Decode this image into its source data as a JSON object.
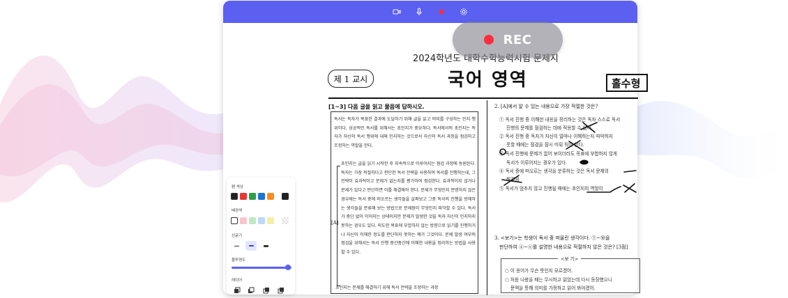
{
  "titlebar": {
    "icons": [
      "video-icon",
      "microphone-icon",
      "record-icon",
      "settings-icon"
    ],
    "accent": "#5b60f0"
  },
  "recording": {
    "label": "REC",
    "dot_color": "#ff2d3d"
  },
  "document": {
    "header_line": "2024학년도 대학수학능력시험 문제지",
    "session": "제 1 교시",
    "subject": "국어 영역",
    "required": "홀수형",
    "left": {
      "question_range": "[1~3] 다음 글을 읽고 물음에 답하시오.",
      "para1": "독서는 독자가 목표한 결과에 도달하기 위해 글을 읽고 의미를 구성하는 인지 행위이다. 성공적인 독서를 위해서는 초인지가 중요하다. 독서에서의 초인지는 독자가 자신의 독서 행위에 대해 인지하는 것으로서 자신의 독서 과정을 점검하고 조정하는 역할을 한다.",
      "para2": "초인지는 글을 읽기 시작한 후 지속적으로 이루어지는 점검 과정에 동원된다. 독자는 가장 적절하다고 판단한 독서 전략을 사용하여 독서를 진행하는데, 그 전략이 효과적이고 문제가 없는지를 평가하여 점검한다. 효과적이지 않거나 문제가 있다고 판단하면 이를 해결해야 한다. 문제가 무엇인지 분명하지 않은 경우에는 독서 중에 떠오르는 생각들을 살펴보고 그중 독서의 진행을 방해하는 생각들을 분류해 보는 방법으로 문제점이 무엇인지 파악할 수 있다. 독서가 중단 없이 이어지는 상태이지만 문제가 발생한 것을 독자 자신이 인지하지 못하는 경우도 있다. 의도한 목표에 부합하지 않는 방향으로 읽기를 진행하거나 자신이 이해한 정도를 판단하지 못하는 예가 그것이다. 문제 발생 여부의 점검을 위해서는 독서 진행 중간중간에 이해한 내용을 정리하는 방법을 사용할 수 있다.",
      "bracket": "[A]",
      "para3_start": "초인지는 문제를 해결하기 위해 독서 전략을 조정하는 과정"
    },
    "right": {
      "q2": "2. [A]에서 알 수 있는 내용으로 가장 적절한 것은?",
      "q2_options": [
        "① 독서 진행 중 이해한 내용을 정리하는 것은 독자 스스로 독서",
        "진행의 문제를 점검하는 데에 적용할 수 있다.",
        "② 독서 진행 중 독자가 자신이 얼마나 이해하는지 파악하지",
        "못할 때에는 점검을 잠시 미뤄 둬야 한다.",
        "③ 독서 진행에 문제가 없어 보이더라도 목표에 부합하지 않게",
        "독서가 이루어지는 경우가 있다.",
        "④ 독서 중에 떠오르는 생각을 분류하는 것은 독서 문제의",
        "해결에",
        "⑤ 독서가 멈추지 않고 진행될 때에는 초인지의 역할이"
      ],
      "q3": "3. <보기>는 학생이 독서 중 떠올린 생각이다. ①~⑩을",
      "q3_line2": "판단하여 ⓐ~ⓔ를 설명한 내용으로 적절하지 않은 것은? [3점]",
      "bogi_label": "<보 기>",
      "bogi_lines": [
        "○ 이 용어가 무슨 뜻인지 모르겠어.",
        "○ 처음 나왔을 때는 무시하고 읽었는데 다시 등장했으니",
        "문맥을 통해 의미를 가정하고 읽어 봐야겠어."
      ]
    }
  },
  "tool_panel": {
    "pen_color_label": "펜 색상",
    "pen_colors": [
      "#222222",
      "#e53935",
      "#2e9e4a",
      "#1e73d8",
      "#ff8c1a",
      "#222222"
    ],
    "bg_color_label": "배경색",
    "bg_colors": [
      "#ffffff",
      "#f6c6cf",
      "#bfe8c4",
      "#bdd9f5",
      "#f7eea4"
    ],
    "thickness_label": "선굵기",
    "opacity_label": "불투명도",
    "opacity": 1.0,
    "layer_label": "레이어"
  }
}
